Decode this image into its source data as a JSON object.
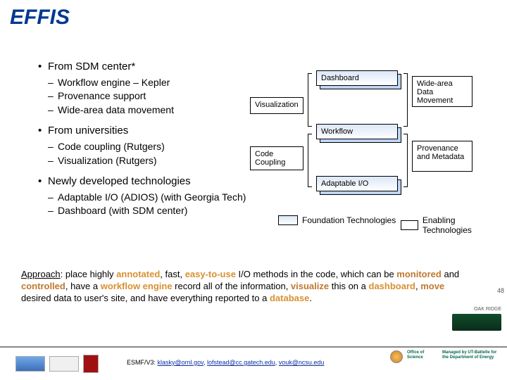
{
  "title": "EFFIS",
  "left_column": {
    "b1": "From SDM center*",
    "b1_subs": [
      "Workflow engine – Kepler",
      "Provenance support",
      "Wide-area data movement"
    ],
    "b2": "From universities",
    "b2_subs": [
      "Code coupling (Rutgers)",
      "Visualization (Rutgers)"
    ],
    "b3": "Newly developed technologies",
    "b3_subs": [
      "Adaptable I/O (ADIOS) (with Georgia Tech)",
      "Dashboard (with SDM center)"
    ]
  },
  "diagram": {
    "visualization": "Visualization",
    "code_coupling": "Code Coupling",
    "dashboard": "Dashboard",
    "workflow": "Workflow",
    "adaptable_io": "Adaptable I/O",
    "wide_area": "Wide-area Data Movement",
    "provenance": "Provenance and Metadata",
    "legend_foundation": "Foundation Technologies",
    "legend_enabling": "Enabling Technologies"
  },
  "approach": {
    "label": "Approach",
    "part1": ": place highly ",
    "hl1": "annotated",
    "part2": ", fast, ",
    "hl2": "easy-to-use",
    "part3": " I/O methods in the code, which can be ",
    "hl3": "monitored",
    "part4": " and ",
    "hl4": "controlled",
    "part5": ", have a ",
    "hl5": "workflow engine",
    "part6": " record all of the information, ",
    "hl6": "visualize",
    "part7": " this on a ",
    "hl7": "dashboard",
    "part8": ", ",
    "hl8": "move",
    "part9": " desired data to user's site, and have everything reported to a ",
    "hl9": "database",
    "part10": "."
  },
  "footer": {
    "credits_prefix": "ESMF/V3: ",
    "email1": "klasky@ornl.gov",
    "sep1": ", ",
    "email2": "lofstead@cc.gatech.edu",
    "sep2": ", ",
    "email3": "vouk@ncsu.edu",
    "managed": "Managed by UT-Battelle for the Department of Energy",
    "ornl_label": "OAK RIDGE",
    "office": "Office of Science"
  },
  "page_number": "48"
}
